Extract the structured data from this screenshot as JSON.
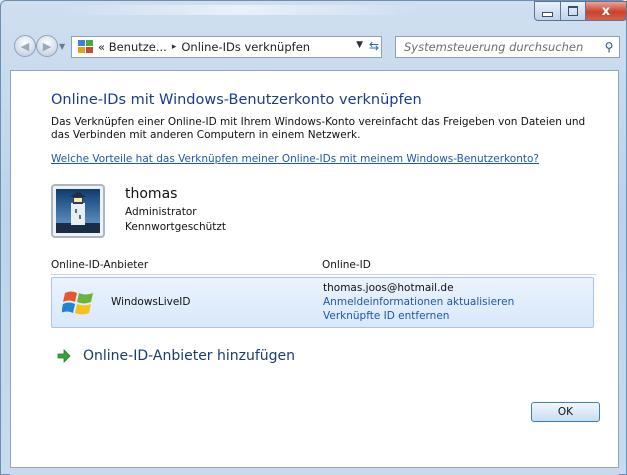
{
  "window": {
    "close_glyph": "x"
  },
  "nav": {
    "breadcrumb": [
      "« Benutze...",
      "Online-IDs verknüpfen"
    ],
    "breadcrumb_separator": "▸",
    "search_placeholder": "Systemsteuerung durchsuchen",
    "icons": [
      "back-icon",
      "forward-icon",
      "control-panel-icon",
      "refresh-icon",
      "search-icon"
    ]
  },
  "page": {
    "title": "Online-IDs mit Windows-Benutzerkonto verknüpfen",
    "description": "Das Verknüpfen einer Online-ID mit Ihrem Windows-Konto vereinfacht das Freigeben von Dateien und das Verbinden mit anderen Computern in einem Netzwerk.",
    "help_link": "Welche Vorteile hat das Verknüpfen meiner Online-IDs mit meinem Windows-Benutzerkonto?"
  },
  "user": {
    "name": "thomas",
    "role": "Administrator",
    "protection": "Kennwortgeschützt"
  },
  "table": {
    "col_provider": "Online-ID-Anbieter",
    "col_online_id": "Online-ID",
    "rows": [
      {
        "provider": "WindowsLiveID",
        "email": "thomas.joos@hotmail.de",
        "link_update": "Anmeldeinformationen aktualisieren",
        "link_remove": "Verknüpfte ID entfernen"
      }
    ]
  },
  "add_provider_label": "Online-ID-Anbieter hinzufügen",
  "ok_label": "OK",
  "colors": {
    "title": "#1b3c8c",
    "link": "#1e57a8",
    "row_bg": "#e3eefc"
  }
}
